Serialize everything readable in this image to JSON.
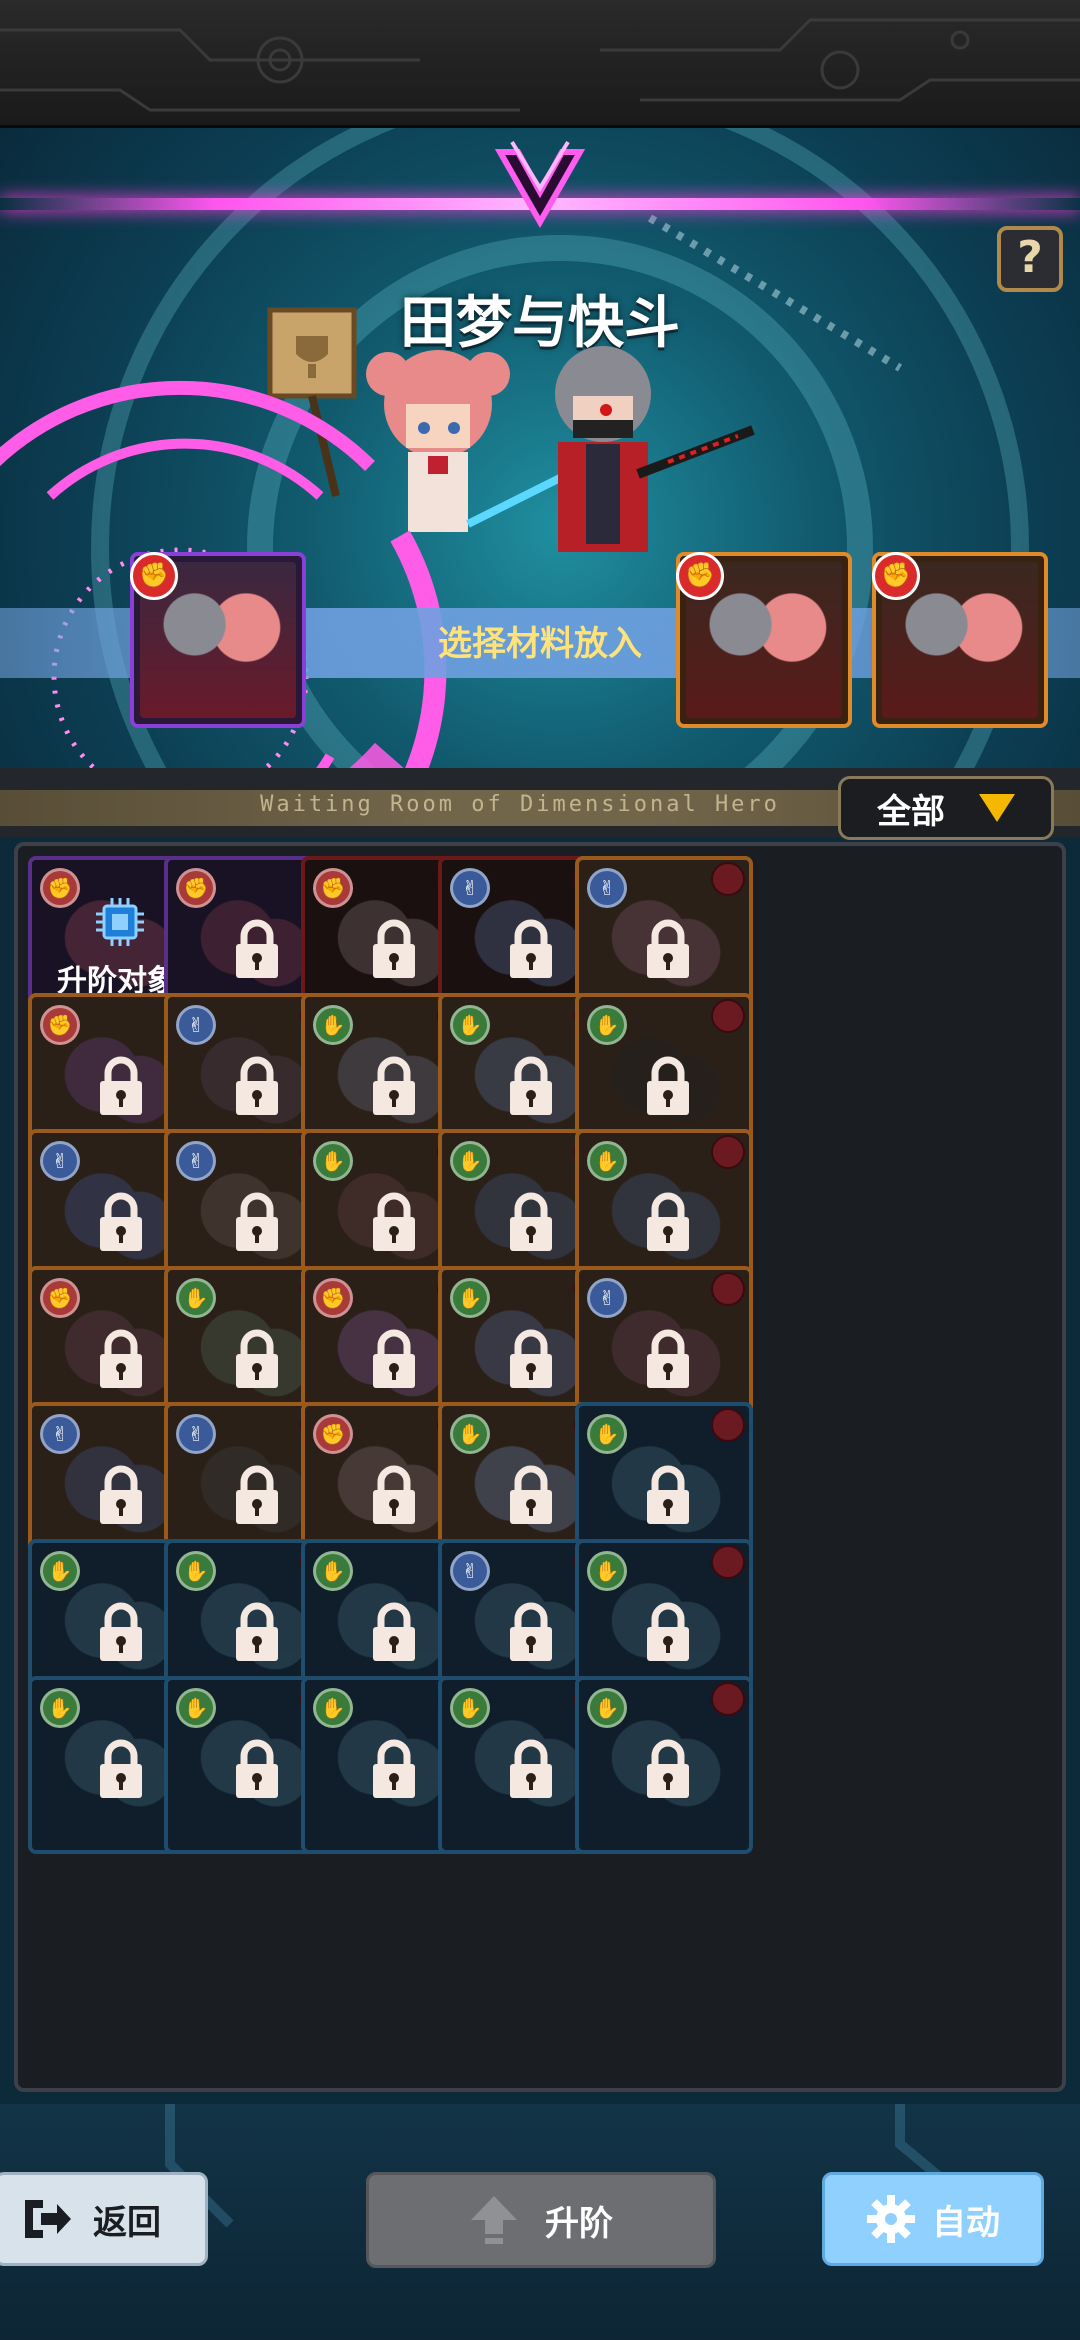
{
  "hero": {
    "name": "田梦与快斗"
  },
  "help": {
    "label": "?"
  },
  "upgrade_area": {
    "select_prompt": "选择材料放入",
    "target_badge": "fist",
    "material_badges": [
      "fist",
      "fist"
    ]
  },
  "waiting_room": {
    "label": "Waiting Room of Dimensional Hero",
    "filter_label": "全部"
  },
  "grid": {
    "first_caption": "升阶对象",
    "cells": [
      {
        "frame": "purple",
        "type": "fist",
        "locked": false,
        "tint": "#7a3a4a"
      },
      {
        "frame": "purple",
        "type": "fist",
        "locked": true,
        "tint": "#6a3545"
      },
      {
        "frame": "red",
        "type": "fist",
        "locked": true,
        "tint": "#6a5a5a"
      },
      {
        "frame": "red",
        "type": "scissors",
        "locked": true,
        "tint": "#4a5a7a"
      },
      {
        "frame": "orange",
        "type": "scissors",
        "locked": true,
        "tint": "#6a4a5a"
      },
      {
        "frame": "orange",
        "type": "fist",
        "locked": true,
        "tint": "#5a3a6a"
      },
      {
        "frame": "orange",
        "type": "scissors",
        "locked": true,
        "tint": "#4a3a4a"
      },
      {
        "frame": "orange",
        "type": "paper",
        "locked": true,
        "tint": "#5a5a6a"
      },
      {
        "frame": "orange",
        "type": "paper",
        "locked": true,
        "tint": "#4a5a7a"
      },
      {
        "frame": "orange",
        "type": "paper",
        "locked": true,
        "tint": "#202020"
      },
      {
        "frame": "orange",
        "type": "scissors",
        "locked": true,
        "tint": "#3a4a7a"
      },
      {
        "frame": "orange",
        "type": "scissors",
        "locked": true,
        "tint": "#5a4a4a"
      },
      {
        "frame": "orange",
        "type": "paper",
        "locked": true,
        "tint": "#5a3a3a"
      },
      {
        "frame": "orange",
        "type": "paper",
        "locked": true,
        "tint": "#3a4a6a"
      },
      {
        "frame": "orange",
        "type": "paper",
        "locked": true,
        "tint": "#3a4a6a"
      },
      {
        "frame": "orange",
        "type": "fist",
        "locked": true,
        "tint": "#5a3a4a"
      },
      {
        "frame": "orange",
        "type": "paper",
        "locked": true,
        "tint": "#4a5a4a"
      },
      {
        "frame": "orange",
        "type": "fist",
        "locked": true,
        "tint": "#6a4a7a"
      },
      {
        "frame": "orange",
        "type": "paper",
        "locked": true,
        "tint": "#4a5a7a"
      },
      {
        "frame": "orange",
        "type": "scissors",
        "locked": true,
        "tint": "#5a3a4a"
      },
      {
        "frame": "orange",
        "type": "scissors",
        "locked": true,
        "tint": "#3a4a6a"
      },
      {
        "frame": "orange",
        "type": "scissors",
        "locked": true,
        "tint": "#3a3a3a"
      },
      {
        "frame": "orange",
        "type": "fist",
        "locked": true,
        "tint": "#6a5a5a"
      },
      {
        "frame": "orange",
        "type": "paper",
        "locked": true,
        "tint": "#5a6a8a"
      },
      {
        "frame": "blue",
        "type": "paper",
        "locked": true,
        "tint": "#3a5a6a"
      },
      {
        "frame": "blue",
        "type": "paper",
        "locked": true,
        "tint": "#3a5a6a"
      },
      {
        "frame": "blue",
        "type": "paper",
        "locked": true,
        "tint": "#3a5a6a"
      },
      {
        "frame": "blue",
        "type": "paper",
        "locked": true,
        "tint": "#3a5a6a"
      },
      {
        "frame": "blue",
        "type": "scissors",
        "locked": true,
        "tint": "#3a5a6a"
      },
      {
        "frame": "blue",
        "type": "paper",
        "locked": true,
        "tint": "#3a5a6a"
      }
    ]
  },
  "buttons": {
    "back": "返回",
    "upgrade": "升阶",
    "auto": "自动"
  },
  "colors": {
    "accent_pink": "#ff55ee",
    "prompt_yellow": "#ffe27a",
    "auto_blue": "#8fd0ff",
    "disabled_gray": "#6c6e72"
  }
}
